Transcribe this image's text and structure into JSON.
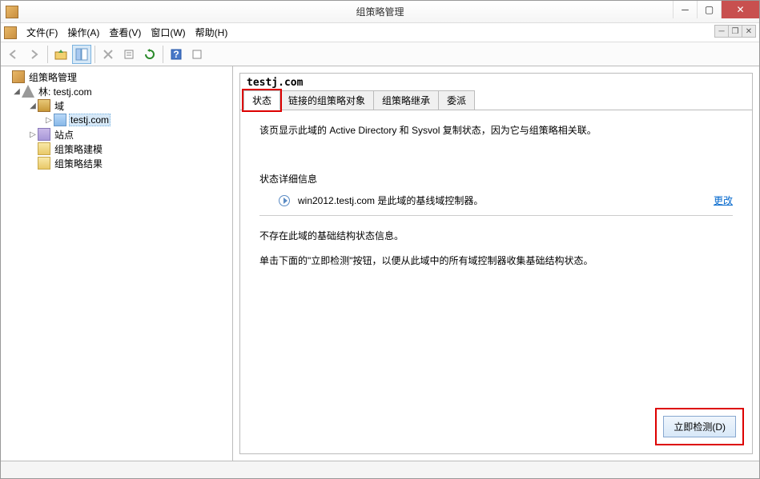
{
  "window": {
    "title": "组策略管理"
  },
  "menu": {
    "file": "文件(F)",
    "action": "操作(A)",
    "view": "查看(V)",
    "window": "窗口(W)",
    "help": "帮助(H)"
  },
  "tree": {
    "root": "组策略管理",
    "forest": "林: testj.com",
    "domains": "域",
    "domain_name": "testj.com",
    "sites": "站点",
    "gp_modeling": "组策略建模",
    "gp_results": "组策略结果"
  },
  "detail": {
    "title": "testj.com",
    "tabs": {
      "status": "状态",
      "linked_gpo": "链接的组策略对象",
      "inheritance": "组策略继承",
      "delegation": "委派"
    },
    "description": "该页显示此域的 Active Directory 和 Sysvol 复制状态，因为它与组策略相关联。",
    "status_detail_label": "状态详细信息",
    "baseline_text": "win2012.testj.com 是此域的基线域控制器。",
    "change_link": "更改",
    "no_info": "不存在此域的基础结构状态信息。",
    "instruction": "单击下面的\"立即检测\"按钮，以便从此域中的所有域控制器收集基础结构状态。",
    "detect_btn": "立即检测(D)"
  }
}
